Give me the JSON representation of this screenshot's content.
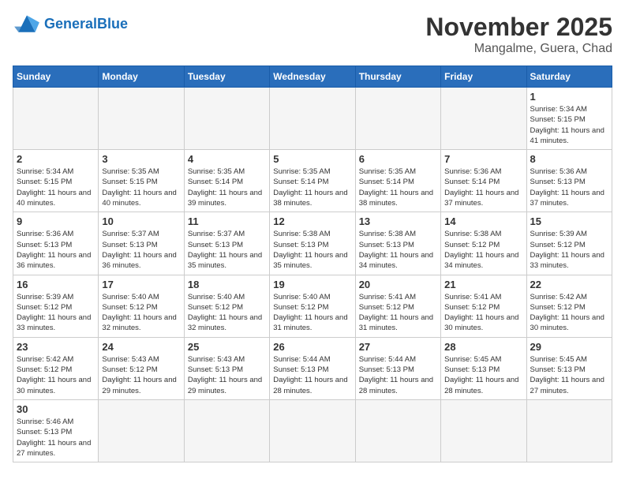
{
  "header": {
    "logo_general": "General",
    "logo_blue": "Blue",
    "month_title": "November 2025",
    "location": "Mangalme, Guera, Chad"
  },
  "weekdays": [
    "Sunday",
    "Monday",
    "Tuesday",
    "Wednesday",
    "Thursday",
    "Friday",
    "Saturday"
  ],
  "weeks": [
    [
      {
        "day": "",
        "info": ""
      },
      {
        "day": "",
        "info": ""
      },
      {
        "day": "",
        "info": ""
      },
      {
        "day": "",
        "info": ""
      },
      {
        "day": "",
        "info": ""
      },
      {
        "day": "",
        "info": ""
      },
      {
        "day": "1",
        "info": "Sunrise: 5:34 AM\nSunset: 5:15 PM\nDaylight: 11 hours and 41 minutes."
      }
    ],
    [
      {
        "day": "2",
        "info": "Sunrise: 5:34 AM\nSunset: 5:15 PM\nDaylight: 11 hours and 40 minutes."
      },
      {
        "day": "3",
        "info": "Sunrise: 5:35 AM\nSunset: 5:15 PM\nDaylight: 11 hours and 40 minutes."
      },
      {
        "day": "4",
        "info": "Sunrise: 5:35 AM\nSunset: 5:14 PM\nDaylight: 11 hours and 39 minutes."
      },
      {
        "day": "5",
        "info": "Sunrise: 5:35 AM\nSunset: 5:14 PM\nDaylight: 11 hours and 38 minutes."
      },
      {
        "day": "6",
        "info": "Sunrise: 5:35 AM\nSunset: 5:14 PM\nDaylight: 11 hours and 38 minutes."
      },
      {
        "day": "7",
        "info": "Sunrise: 5:36 AM\nSunset: 5:14 PM\nDaylight: 11 hours and 37 minutes."
      },
      {
        "day": "8",
        "info": "Sunrise: 5:36 AM\nSunset: 5:13 PM\nDaylight: 11 hours and 37 minutes."
      }
    ],
    [
      {
        "day": "9",
        "info": "Sunrise: 5:36 AM\nSunset: 5:13 PM\nDaylight: 11 hours and 36 minutes."
      },
      {
        "day": "10",
        "info": "Sunrise: 5:37 AM\nSunset: 5:13 PM\nDaylight: 11 hours and 36 minutes."
      },
      {
        "day": "11",
        "info": "Sunrise: 5:37 AM\nSunset: 5:13 PM\nDaylight: 11 hours and 35 minutes."
      },
      {
        "day": "12",
        "info": "Sunrise: 5:38 AM\nSunset: 5:13 PM\nDaylight: 11 hours and 35 minutes."
      },
      {
        "day": "13",
        "info": "Sunrise: 5:38 AM\nSunset: 5:13 PM\nDaylight: 11 hours and 34 minutes."
      },
      {
        "day": "14",
        "info": "Sunrise: 5:38 AM\nSunset: 5:12 PM\nDaylight: 11 hours and 34 minutes."
      },
      {
        "day": "15",
        "info": "Sunrise: 5:39 AM\nSunset: 5:12 PM\nDaylight: 11 hours and 33 minutes."
      }
    ],
    [
      {
        "day": "16",
        "info": "Sunrise: 5:39 AM\nSunset: 5:12 PM\nDaylight: 11 hours and 33 minutes."
      },
      {
        "day": "17",
        "info": "Sunrise: 5:40 AM\nSunset: 5:12 PM\nDaylight: 11 hours and 32 minutes."
      },
      {
        "day": "18",
        "info": "Sunrise: 5:40 AM\nSunset: 5:12 PM\nDaylight: 11 hours and 32 minutes."
      },
      {
        "day": "19",
        "info": "Sunrise: 5:40 AM\nSunset: 5:12 PM\nDaylight: 11 hours and 31 minutes."
      },
      {
        "day": "20",
        "info": "Sunrise: 5:41 AM\nSunset: 5:12 PM\nDaylight: 11 hours and 31 minutes."
      },
      {
        "day": "21",
        "info": "Sunrise: 5:41 AM\nSunset: 5:12 PM\nDaylight: 11 hours and 30 minutes."
      },
      {
        "day": "22",
        "info": "Sunrise: 5:42 AM\nSunset: 5:12 PM\nDaylight: 11 hours and 30 minutes."
      }
    ],
    [
      {
        "day": "23",
        "info": "Sunrise: 5:42 AM\nSunset: 5:12 PM\nDaylight: 11 hours and 30 minutes."
      },
      {
        "day": "24",
        "info": "Sunrise: 5:43 AM\nSunset: 5:12 PM\nDaylight: 11 hours and 29 minutes."
      },
      {
        "day": "25",
        "info": "Sunrise: 5:43 AM\nSunset: 5:13 PM\nDaylight: 11 hours and 29 minutes."
      },
      {
        "day": "26",
        "info": "Sunrise: 5:44 AM\nSunset: 5:13 PM\nDaylight: 11 hours and 28 minutes."
      },
      {
        "day": "27",
        "info": "Sunrise: 5:44 AM\nSunset: 5:13 PM\nDaylight: 11 hours and 28 minutes."
      },
      {
        "day": "28",
        "info": "Sunrise: 5:45 AM\nSunset: 5:13 PM\nDaylight: 11 hours and 28 minutes."
      },
      {
        "day": "29",
        "info": "Sunrise: 5:45 AM\nSunset: 5:13 PM\nDaylight: 11 hours and 27 minutes."
      }
    ],
    [
      {
        "day": "30",
        "info": "Sunrise: 5:46 AM\nSunset: 5:13 PM\nDaylight: 11 hours and 27 minutes."
      },
      {
        "day": "",
        "info": ""
      },
      {
        "day": "",
        "info": ""
      },
      {
        "day": "",
        "info": ""
      },
      {
        "day": "",
        "info": ""
      },
      {
        "day": "",
        "info": ""
      },
      {
        "day": "",
        "info": ""
      }
    ]
  ]
}
